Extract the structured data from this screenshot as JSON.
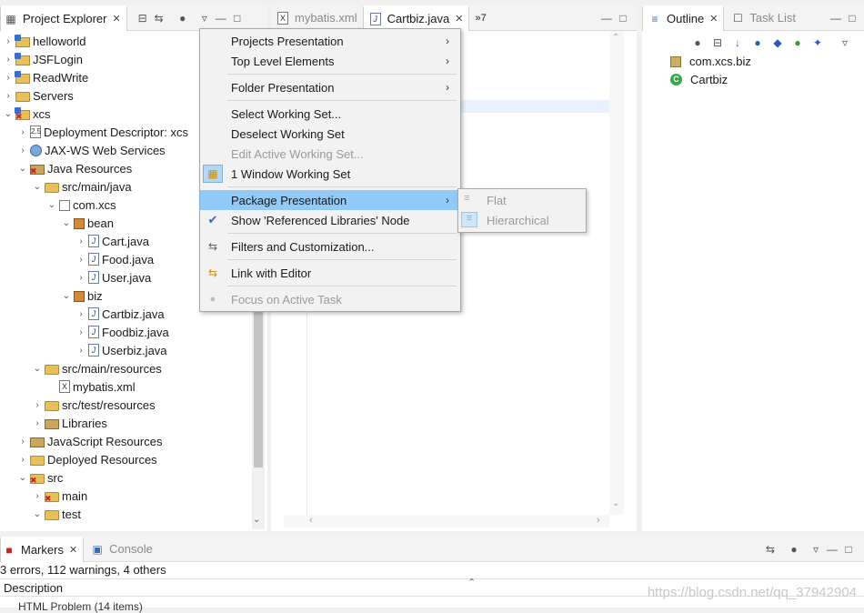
{
  "explorer": {
    "tab_title": "Project Explorer",
    "tree": [
      {
        "label": "helloworld"
      },
      {
        "label": "JSFLogin"
      },
      {
        "label": "ReadWrite"
      },
      {
        "label": "Servers"
      },
      {
        "label": "xcs"
      },
      {
        "label": "Deployment Descriptor: xcs"
      },
      {
        "label": "JAX-WS Web Services"
      },
      {
        "label": "Java Resources"
      },
      {
        "label": "src/main/java"
      },
      {
        "label": "com.xcs"
      },
      {
        "label": "bean"
      },
      {
        "label": "Cart.java"
      },
      {
        "label": "Food.java"
      },
      {
        "label": "User.java"
      },
      {
        "label": "biz"
      },
      {
        "label": "Cartbiz.java"
      },
      {
        "label": "Foodbiz.java"
      },
      {
        "label": "Userbiz.java"
      },
      {
        "label": "src/main/resources"
      },
      {
        "label": "mybatis.xml"
      },
      {
        "label": "src/test/resources"
      },
      {
        "label": "Libraries"
      },
      {
        "label": "JavaScript Resources"
      },
      {
        "label": "Deployed Resources"
      },
      {
        "label": "src"
      },
      {
        "label": "main"
      },
      {
        "label": "test"
      }
    ]
  },
  "editor": {
    "tabs": [
      {
        "label": "mybatis.xml"
      },
      {
        "label": "Cartbiz.java"
      },
      {
        "label": "»7"
      }
    ]
  },
  "outline": {
    "tab_title": "Outline",
    "tab2_title": "Task List",
    "items": [
      {
        "label": "com.xcs.biz"
      },
      {
        "label": "Cartbiz"
      }
    ]
  },
  "menu": {
    "items": [
      {
        "label": "Projects Presentation"
      },
      {
        "label": "Top Level Elements"
      },
      {
        "label": "Folder Presentation"
      },
      {
        "label": "Select Working Set..."
      },
      {
        "label": "Deselect Working Set"
      },
      {
        "label": "Edit Active Working Set..."
      },
      {
        "label": "1 Window Working Set"
      },
      {
        "label": "Package Presentation"
      },
      {
        "label": "Show 'Referenced Libraries' Node"
      },
      {
        "label": "Filters and Customization..."
      },
      {
        "label": "Link with Editor"
      },
      {
        "label": "Focus on Active Task"
      }
    ],
    "submenu": [
      {
        "label": "Flat"
      },
      {
        "label": "Hierarchical"
      }
    ]
  },
  "bottom": {
    "tab_markers": "Markers",
    "tab_console": "Console",
    "summary": "3 errors, 112 warnings, 4 others",
    "column_description": "Description",
    "row_partial": "HTML Problem (14 items)"
  },
  "watermark": "https://blog.csdn.net/qq_37942904",
  "colors": {
    "highlight": "#91c9f7",
    "selection": "#cde8ff"
  }
}
